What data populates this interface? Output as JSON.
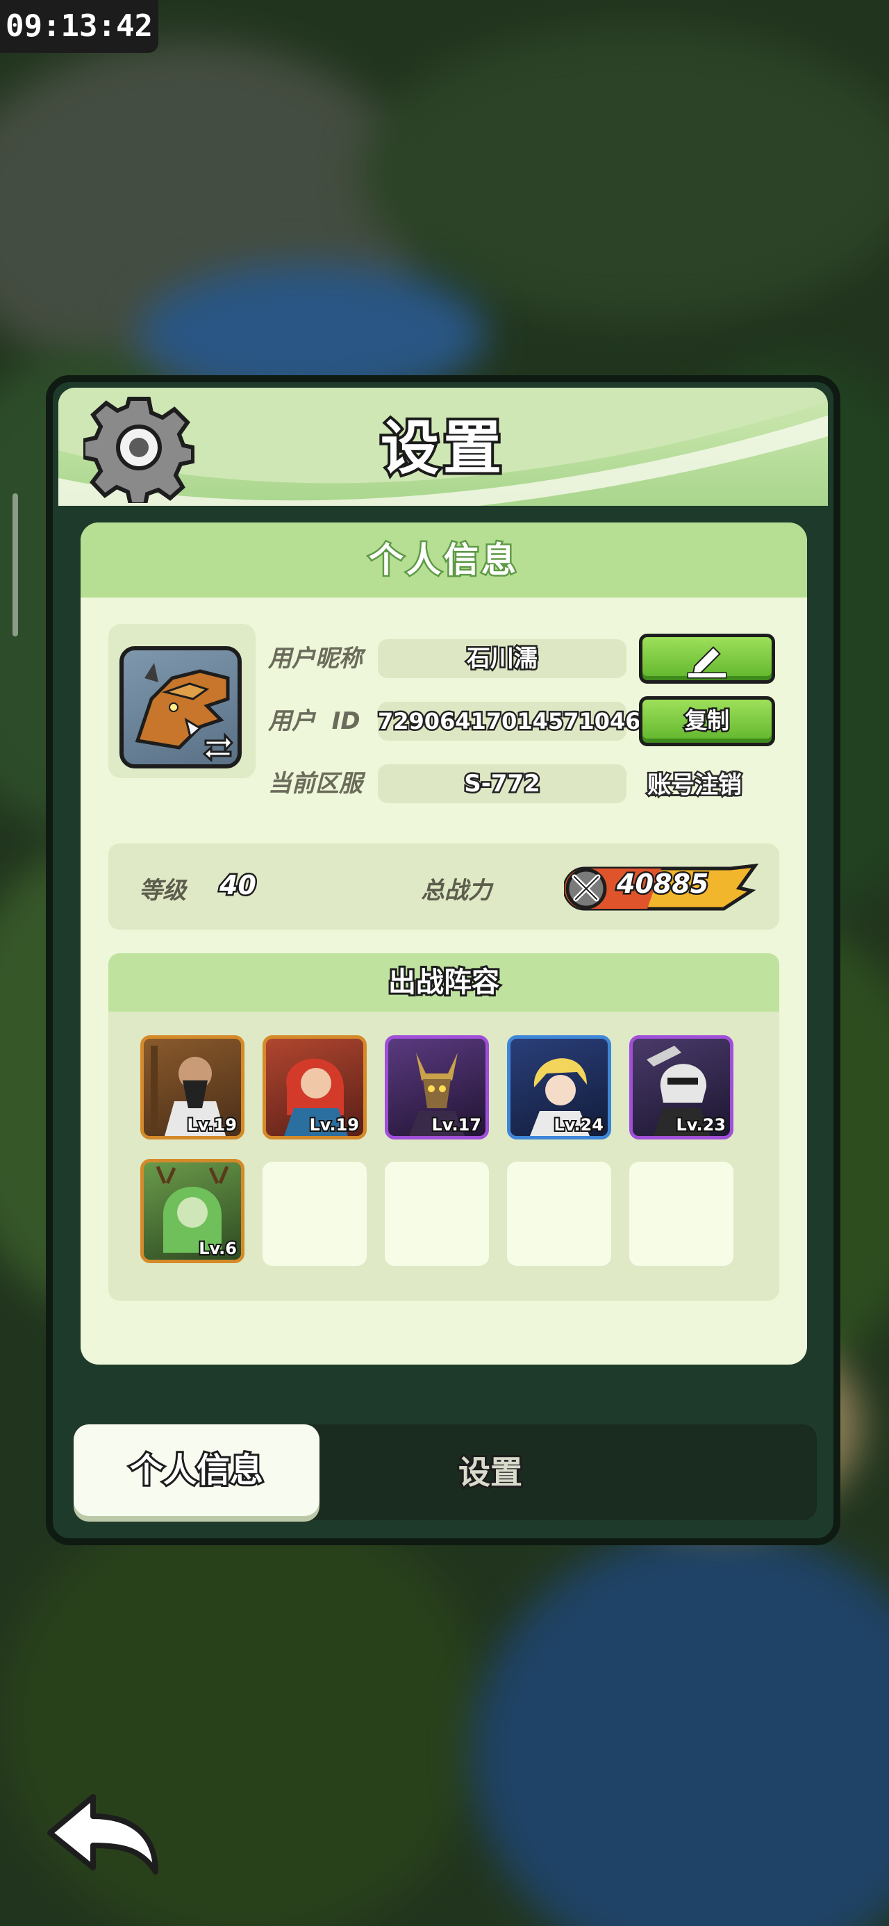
{
  "status": {
    "time": "09:13:42"
  },
  "panel": {
    "title": "设置"
  },
  "profile_card": {
    "header": "个人信息",
    "nickname_label": "用户昵称",
    "nickname": "石川濡",
    "id_label": "用户  ID",
    "user_id": "72906417014571046",
    "copy_label": "复制",
    "server_label": "当前区服",
    "server": "S-772",
    "logout_label": "账号注销"
  },
  "stats": {
    "level_label": "等级",
    "level": "40",
    "power_label": "总战力",
    "power": "40885"
  },
  "lineup": {
    "header": "出战阵容",
    "heroes": [
      {
        "level": "Lv.19",
        "frame": "gold"
      },
      {
        "level": "Lv.19",
        "frame": "gold"
      },
      {
        "level": "Lv.17",
        "frame": "purple"
      },
      {
        "level": "Lv.24",
        "frame": "blue"
      },
      {
        "level": "Lv.23",
        "frame": "purple"
      },
      {
        "level": "Lv.6",
        "frame": "gold"
      }
    ],
    "empty_slots": 4
  },
  "tabs": {
    "active": "个人信息",
    "inactive": "设置"
  },
  "icons": {
    "settings": "gear-icon",
    "edit": "pencil-icon",
    "swap": "swap-arrows-icon",
    "power": "crossed-swords-icon",
    "back": "back-arrow-icon"
  }
}
